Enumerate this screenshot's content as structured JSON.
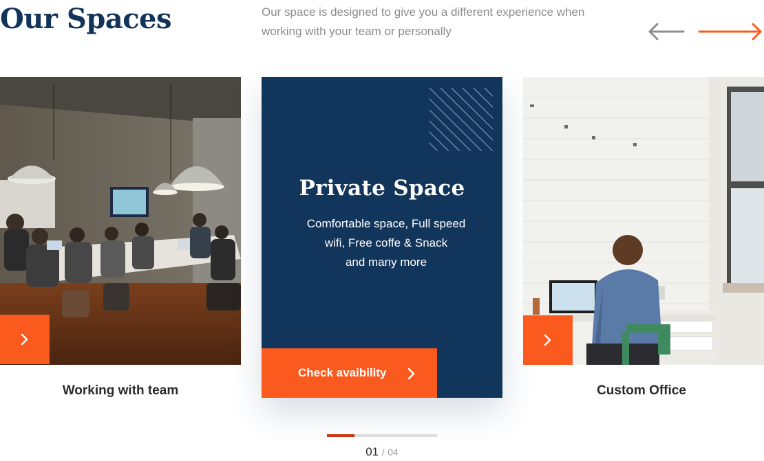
{
  "header": {
    "title": "Our Spaces",
    "description": "Our space is designed to give you a different experience when working with your team or personally",
    "prev_icon": "arrow-left-icon",
    "next_icon": "arrow-right-icon"
  },
  "cards": {
    "left": {
      "caption": "Working with team",
      "photo": "team-meeting-room-photo",
      "button_icon": "chevron-right-icon"
    },
    "right": {
      "caption": "Custom Office",
      "photo": "man-at-desk-office-photo",
      "button_icon": "chevron-right-icon"
    }
  },
  "featured": {
    "title": "Private Space",
    "line1": "Comfortable space, Full speed",
    "line2": "wifi, Free coffe & Snack",
    "line3": "and many more",
    "cta_label": "Check avaibility",
    "cta_icon": "chevron-right-icon",
    "pattern": "diagonal-lines-pattern"
  },
  "pager": {
    "current": "01",
    "separator": "/",
    "total": "04",
    "progress": 0.25
  },
  "colors": {
    "brand_navy": "#12355c",
    "accent_orange": "#fb5a1f",
    "progress_red": "#c83a17"
  }
}
